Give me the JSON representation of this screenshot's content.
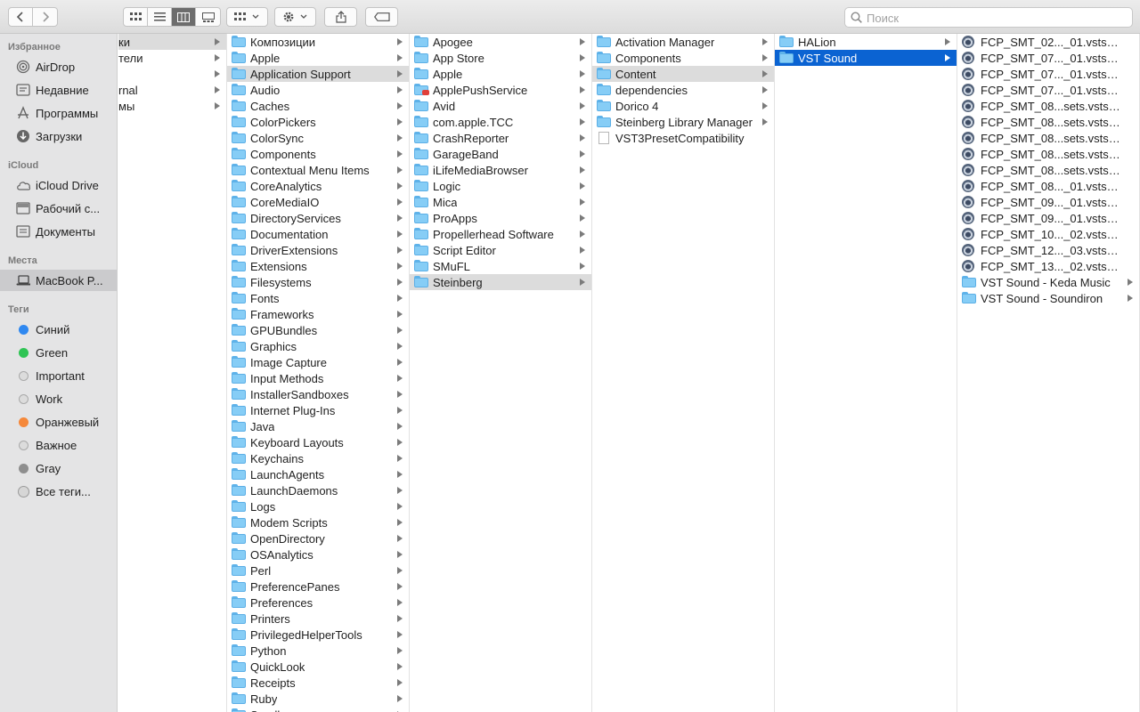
{
  "toolbar": {
    "search_placeholder": "Поиск",
    "view_modes": [
      "icons",
      "list",
      "columns",
      "gallery"
    ],
    "active_view": "columns"
  },
  "sidebar": {
    "favorites_header": "Избранное",
    "favorites": [
      {
        "label": "AirDrop",
        "icon": "airdrop-icon"
      },
      {
        "label": "Недавние",
        "icon": "recents-icon"
      },
      {
        "label": "Программы",
        "icon": "applications-icon"
      },
      {
        "label": "Загрузки",
        "icon": "downloads-icon"
      }
    ],
    "icloud_header": "iCloud",
    "icloud": [
      {
        "label": "iCloud Drive",
        "icon": "cloud-icon"
      },
      {
        "label": "Рабочий с...",
        "icon": "desktop-icon"
      },
      {
        "label": "Документы",
        "icon": "documents-icon"
      }
    ],
    "places_header": "Места",
    "places": [
      {
        "label": "MacBook P...",
        "icon": "laptop-icon",
        "selected": true
      }
    ],
    "tags_header": "Теги",
    "tags": [
      {
        "label": "Синий",
        "color": "#2f88f0"
      },
      {
        "label": "Green",
        "color": "#2fc454"
      },
      {
        "label": "Important",
        "color": "#d4d4d4"
      },
      {
        "label": "Work",
        "color": "#d4d4d4"
      },
      {
        "label": "Оранжевый",
        "color": "#f5883a"
      },
      {
        "label": "Важное",
        "color": "#d4d4d4"
      },
      {
        "label": "Gray",
        "color": "#8e8e8e"
      },
      {
        "label": "Все теги...",
        "color": "#c8c8c8"
      }
    ]
  },
  "columns": [
    {
      "items": [
        {
          "name": "ки",
          "type": "folder-partial",
          "arrow": true,
          "selected": "gray"
        },
        {
          "name": "тели",
          "type": "folder-partial",
          "arrow": true
        },
        {
          "name": "",
          "type": "folder-partial",
          "arrow": true
        },
        {
          "name": "rnal",
          "type": "folder-partial",
          "arrow": true
        },
        {
          "name": "мы",
          "type": "folder-partial",
          "arrow": true
        }
      ]
    },
    {
      "items": [
        {
          "name": "Композиции",
          "type": "folder",
          "arrow": true
        },
        {
          "name": "Apple",
          "type": "folder",
          "arrow": true
        },
        {
          "name": "Application Support",
          "type": "folder",
          "arrow": true,
          "selected": "gray"
        },
        {
          "name": "Audio",
          "type": "folder",
          "arrow": true
        },
        {
          "name": "Caches",
          "type": "folder",
          "arrow": true
        },
        {
          "name": "ColorPickers",
          "type": "folder",
          "arrow": true
        },
        {
          "name": "ColorSync",
          "type": "folder",
          "arrow": true
        },
        {
          "name": "Components",
          "type": "folder",
          "arrow": true
        },
        {
          "name": "Contextual Menu Items",
          "type": "folder",
          "arrow": true
        },
        {
          "name": "CoreAnalytics",
          "type": "folder",
          "arrow": true
        },
        {
          "name": "CoreMediaIO",
          "type": "folder",
          "arrow": true
        },
        {
          "name": "DirectoryServices",
          "type": "folder",
          "arrow": true
        },
        {
          "name": "Documentation",
          "type": "folder",
          "arrow": true
        },
        {
          "name": "DriverExtensions",
          "type": "folder",
          "arrow": true
        },
        {
          "name": "Extensions",
          "type": "folder",
          "arrow": true
        },
        {
          "name": "Filesystems",
          "type": "folder",
          "arrow": true
        },
        {
          "name": "Fonts",
          "type": "folder",
          "arrow": true
        },
        {
          "name": "Frameworks",
          "type": "folder",
          "arrow": true
        },
        {
          "name": "GPUBundles",
          "type": "folder",
          "arrow": true
        },
        {
          "name": "Graphics",
          "type": "folder",
          "arrow": true
        },
        {
          "name": "Image Capture",
          "type": "folder",
          "arrow": true
        },
        {
          "name": "Input Methods",
          "type": "folder",
          "arrow": true
        },
        {
          "name": "InstallerSandboxes",
          "type": "folder",
          "arrow": true
        },
        {
          "name": "Internet Plug-Ins",
          "type": "folder",
          "arrow": true
        },
        {
          "name": "Java",
          "type": "folder",
          "arrow": true
        },
        {
          "name": "Keyboard Layouts",
          "type": "folder",
          "arrow": true
        },
        {
          "name": "Keychains",
          "type": "folder",
          "arrow": true
        },
        {
          "name": "LaunchAgents",
          "type": "folder",
          "arrow": true
        },
        {
          "name": "LaunchDaemons",
          "type": "folder",
          "arrow": true
        },
        {
          "name": "Logs",
          "type": "folder",
          "arrow": true
        },
        {
          "name": "Modem Scripts",
          "type": "folder",
          "arrow": true
        },
        {
          "name": "OpenDirectory",
          "type": "folder",
          "arrow": true
        },
        {
          "name": "OSAnalytics",
          "type": "folder",
          "arrow": true
        },
        {
          "name": "Perl",
          "type": "folder",
          "arrow": true
        },
        {
          "name": "PreferencePanes",
          "type": "folder",
          "arrow": true
        },
        {
          "name": "Preferences",
          "type": "folder",
          "arrow": true
        },
        {
          "name": "Printers",
          "type": "folder",
          "arrow": true
        },
        {
          "name": "PrivilegedHelperTools",
          "type": "folder",
          "arrow": true
        },
        {
          "name": "Python",
          "type": "folder",
          "arrow": true
        },
        {
          "name": "QuickLook",
          "type": "folder",
          "arrow": true
        },
        {
          "name": "Receipts",
          "type": "folder",
          "arrow": true
        },
        {
          "name": "Ruby",
          "type": "folder",
          "arrow": true
        },
        {
          "name": "Sandbox",
          "type": "folder",
          "arrow": true
        }
      ]
    },
    {
      "items": [
        {
          "name": "Apogee",
          "type": "folder",
          "arrow": true
        },
        {
          "name": "App Store",
          "type": "folder",
          "arrow": true
        },
        {
          "name": "Apple",
          "type": "folder",
          "arrow": true
        },
        {
          "name": "ApplePushService",
          "type": "folder-badge",
          "arrow": true
        },
        {
          "name": "Avid",
          "type": "folder",
          "arrow": true
        },
        {
          "name": "com.apple.TCC",
          "type": "folder",
          "arrow": true
        },
        {
          "name": "CrashReporter",
          "type": "folder",
          "arrow": true
        },
        {
          "name": "GarageBand",
          "type": "folder",
          "arrow": true
        },
        {
          "name": "iLifeMediaBrowser",
          "type": "folder",
          "arrow": true
        },
        {
          "name": "Logic",
          "type": "folder",
          "arrow": true
        },
        {
          "name": "Mica",
          "type": "folder",
          "arrow": true
        },
        {
          "name": "ProApps",
          "type": "folder",
          "arrow": true
        },
        {
          "name": "Propellerhead Software",
          "type": "folder",
          "arrow": true
        },
        {
          "name": "Script Editor",
          "type": "folder",
          "arrow": true
        },
        {
          "name": "SMuFL",
          "type": "folder",
          "arrow": true
        },
        {
          "name": "Steinberg",
          "type": "folder",
          "arrow": true,
          "selected": "gray"
        }
      ]
    },
    {
      "items": [
        {
          "name": "Activation Manager",
          "type": "folder",
          "arrow": true
        },
        {
          "name": "Components",
          "type": "folder",
          "arrow": true
        },
        {
          "name": "Content",
          "type": "folder",
          "arrow": true,
          "selected": "gray"
        },
        {
          "name": "dependencies",
          "type": "folder",
          "arrow": true
        },
        {
          "name": "Dorico 4",
          "type": "folder",
          "arrow": true
        },
        {
          "name": "Steinberg Library Manager",
          "type": "folder",
          "arrow": true
        },
        {
          "name": "VST3PresetCompatibility",
          "type": "doc",
          "arrow": false
        }
      ]
    },
    {
      "items": [
        {
          "name": "HALion",
          "type": "folder",
          "arrow": true
        },
        {
          "name": "VST Sound",
          "type": "folder",
          "arrow": true,
          "selected": "blue"
        }
      ]
    },
    {
      "items": [
        {
          "name": "FCP_SMT_02..._01.vstsound",
          "type": "vst",
          "arrow": false
        },
        {
          "name": "FCP_SMT_07..._01.vstsound",
          "type": "vst",
          "arrow": false
        },
        {
          "name": "FCP_SMT_07..._01.vstsound",
          "type": "vst",
          "arrow": false
        },
        {
          "name": "FCP_SMT_07..._01.vstsound",
          "type": "vst",
          "arrow": false
        },
        {
          "name": "FCP_SMT_08...sets.vstsound",
          "type": "vst",
          "arrow": false
        },
        {
          "name": "FCP_SMT_08...sets.vstsound",
          "type": "vst",
          "arrow": false
        },
        {
          "name": "FCP_SMT_08...sets.vstsound",
          "type": "vst",
          "arrow": false
        },
        {
          "name": "FCP_SMT_08...sets.vstsound",
          "type": "vst",
          "arrow": false
        },
        {
          "name": "FCP_SMT_08...sets.vstsound",
          "type": "vst",
          "arrow": false
        },
        {
          "name": "FCP_SMT_08..._01.vstsound",
          "type": "vst",
          "arrow": false
        },
        {
          "name": "FCP_SMT_09..._01.vstsound",
          "type": "vst",
          "arrow": false
        },
        {
          "name": "FCP_SMT_09..._01.vstsound",
          "type": "vst",
          "arrow": false
        },
        {
          "name": "FCP_SMT_10..._02.vstsound",
          "type": "vst",
          "arrow": false
        },
        {
          "name": "FCP_SMT_12..._03.vstsound",
          "type": "vst",
          "arrow": false
        },
        {
          "name": "FCP_SMT_13..._02.vstsound",
          "type": "vst",
          "arrow": false
        },
        {
          "name": "VST Sound - Keda Music",
          "type": "folder",
          "arrow": true
        },
        {
          "name": "VST Sound - Soundiron",
          "type": "folder",
          "arrow": true
        }
      ]
    }
  ]
}
